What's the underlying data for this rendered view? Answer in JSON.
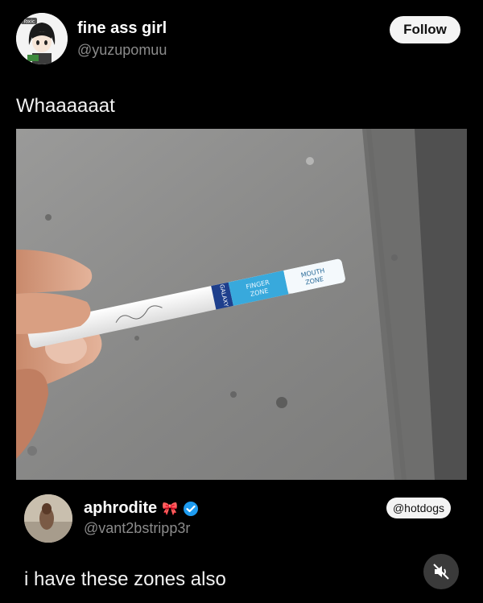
{
  "post": {
    "author_name": "fine ass girl",
    "author_handle": "@yuzupomuu",
    "follow_label": "Follow",
    "text": "Whaaaaaat",
    "avatar_icon": "anime-avatar-icon",
    "avatar_badge_text": "Toxic"
  },
  "photo": {
    "brand_text": "GALAXY",
    "finger_zone_label": "FINGER\nZONE",
    "mouth_zone_label": "MOUTH\nZONE",
    "zone_color": "#38a9dc",
    "brand_band_color": "#1e3f8c"
  },
  "quote": {
    "author_name": "aphrodite",
    "name_emoji": "🎀",
    "author_handle": "@vant2bstripp3r",
    "verified_icon": "verified-check-icon",
    "verified_color": "#1d9bf0",
    "badge_label": "@hotdogs",
    "text": "i have these zones also",
    "mute_icon": "speaker-muted-icon"
  }
}
